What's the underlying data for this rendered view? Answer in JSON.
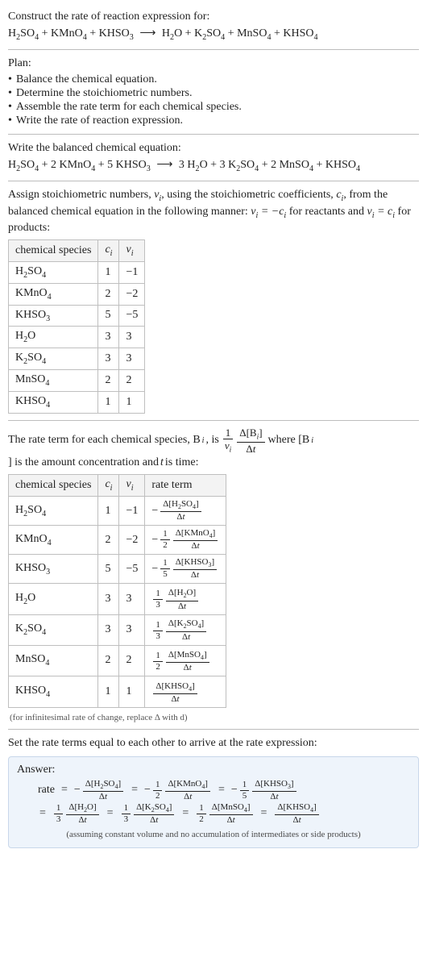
{
  "header": {
    "prompt": "Construct the rate of reaction expression for:",
    "unbalanced_lhs": [
      "H2SO4",
      "KMnO4",
      "KHSO3"
    ],
    "unbalanced_rhs": [
      "H2O",
      "K2SO4",
      "MnSO4",
      "KHSO4"
    ]
  },
  "plan": {
    "title": "Plan:",
    "items": [
      "Balance the chemical equation.",
      "Determine the stoichiometric numbers.",
      "Assemble the rate term for each chemical species.",
      "Write the rate of reaction expression."
    ]
  },
  "balanced": {
    "title": "Write the balanced chemical equation:",
    "lhs": [
      {
        "coef": "",
        "species": "H2SO4"
      },
      {
        "coef": "2",
        "species": "KMnO4"
      },
      {
        "coef": "5",
        "species": "KHSO3"
      }
    ],
    "rhs": [
      {
        "coef": "3",
        "species": "H2O"
      },
      {
        "coef": "3",
        "species": "K2SO4"
      },
      {
        "coef": "2",
        "species": "MnSO4"
      },
      {
        "coef": "",
        "species": "KHSO4"
      }
    ]
  },
  "stoich_intro": {
    "text_a": "Assign stoichiometric numbers, ",
    "text_b": ", using the stoichiometric coefficients, ",
    "text_c": ", from the balanced chemical equation in the following manner: ",
    "text_d": " for reactants and ",
    "text_e": " for products:",
    "nu": "ν",
    "c": "c",
    "sub": "i"
  },
  "table1": {
    "headers": [
      "chemical species",
      "c_i",
      "ν_i"
    ],
    "rows": [
      {
        "species": "H2SO4",
        "c": "1",
        "nu": "−1"
      },
      {
        "species": "KMnO4",
        "c": "2",
        "nu": "−2"
      },
      {
        "species": "KHSO3",
        "c": "5",
        "nu": "−5"
      },
      {
        "species": "H2O",
        "c": "3",
        "nu": "3"
      },
      {
        "species": "K2SO4",
        "c": "3",
        "nu": "3"
      },
      {
        "species": "MnSO4",
        "c": "2",
        "nu": "2"
      },
      {
        "species": "KHSO4",
        "c": "1",
        "nu": "1"
      }
    ]
  },
  "rate_intro": {
    "a": "The rate term for each chemical species, B",
    "b": ", is ",
    "c": " where [B",
    "d": "] is the amount concentration and ",
    "e": " is time:",
    "t": "t"
  },
  "table2": {
    "headers": [
      "chemical species",
      "c_i",
      "ν_i",
      "rate term"
    ],
    "rows": [
      {
        "species": "H2SO4",
        "c": "1",
        "nu": "−1",
        "sign": "−",
        "coef_num": "",
        "coef_den": "",
        "delta_species": "H2SO4"
      },
      {
        "species": "KMnO4",
        "c": "2",
        "nu": "−2",
        "sign": "−",
        "coef_num": "1",
        "coef_den": "2",
        "delta_species": "KMnO4"
      },
      {
        "species": "KHSO3",
        "c": "5",
        "nu": "−5",
        "sign": "−",
        "coef_num": "1",
        "coef_den": "5",
        "delta_species": "KHSO3"
      },
      {
        "species": "H2O",
        "c": "3",
        "nu": "3",
        "sign": "",
        "coef_num": "1",
        "coef_den": "3",
        "delta_species": "H2O"
      },
      {
        "species": "K2SO4",
        "c": "3",
        "nu": "3",
        "sign": "",
        "coef_num": "1",
        "coef_den": "3",
        "delta_species": "K2SO4"
      },
      {
        "species": "MnSO4",
        "c": "2",
        "nu": "2",
        "sign": "",
        "coef_num": "1",
        "coef_den": "2",
        "delta_species": "MnSO4"
      },
      {
        "species": "KHSO4",
        "c": "1",
        "nu": "1",
        "sign": "",
        "coef_num": "",
        "coef_den": "",
        "delta_species": "KHSO4"
      }
    ]
  },
  "note_infinitesimal": "(for infinitesimal rate of change, replace Δ with d)",
  "rate_equal_line": "Set the rate terms equal to each other to arrive at the rate expression:",
  "answer": {
    "title": "Answer:",
    "lead": "rate",
    "terms": [
      {
        "sign": "−",
        "coef_num": "",
        "coef_den": "",
        "species": "H2SO4"
      },
      {
        "sign": "−",
        "coef_num": "1",
        "coef_den": "2",
        "species": "KMnO4"
      },
      {
        "sign": "−",
        "coef_num": "1",
        "coef_den": "5",
        "species": "KHSO3"
      },
      {
        "sign": "",
        "coef_num": "1",
        "coef_den": "3",
        "species": "H2O"
      },
      {
        "sign": "",
        "coef_num": "1",
        "coef_den": "3",
        "species": "K2SO4"
      },
      {
        "sign": "",
        "coef_num": "1",
        "coef_den": "2",
        "species": "MnSO4"
      },
      {
        "sign": "",
        "coef_num": "",
        "coef_den": "",
        "species": "KHSO4"
      }
    ],
    "note": "(assuming constant volume and no accumulation of intermediates or side products)"
  },
  "symbols": {
    "plus": " + ",
    "arrow": "⟶",
    "delta": "Δ",
    "eq": " = ",
    "minus": "−"
  },
  "chart_data": {
    "type": "table",
    "title": "Stoichiometry and rate terms",
    "tables": [
      {
        "name": "stoichiometric_numbers",
        "columns": [
          "chemical species",
          "c_i",
          "nu_i"
        ],
        "rows": [
          [
            "H2SO4",
            1,
            -1
          ],
          [
            "KMnO4",
            2,
            -2
          ],
          [
            "KHSO3",
            5,
            -5
          ],
          [
            "H2O",
            3,
            3
          ],
          [
            "K2SO4",
            3,
            3
          ],
          [
            "MnSO4",
            2,
            2
          ],
          [
            "KHSO4",
            1,
            1
          ]
        ]
      },
      {
        "name": "rate_terms",
        "columns": [
          "chemical species",
          "c_i",
          "nu_i",
          "rate_term"
        ],
        "rows": [
          [
            "H2SO4",
            1,
            -1,
            "-(Δ[H2SO4]/Δt)"
          ],
          [
            "KMnO4",
            2,
            -2,
            "-(1/2)(Δ[KMnO4]/Δt)"
          ],
          [
            "KHSO3",
            5,
            -5,
            "-(1/5)(Δ[KHSO3]/Δt)"
          ],
          [
            "H2O",
            3,
            3,
            "(1/3)(Δ[H2O]/Δt)"
          ],
          [
            "K2SO4",
            3,
            3,
            "(1/3)(Δ[K2SO4]/Δt)"
          ],
          [
            "MnSO4",
            2,
            2,
            "(1/2)(Δ[MnSO4]/Δt)"
          ],
          [
            "KHSO4",
            1,
            1,
            "(Δ[KHSO4]/Δt)"
          ]
        ]
      }
    ]
  }
}
